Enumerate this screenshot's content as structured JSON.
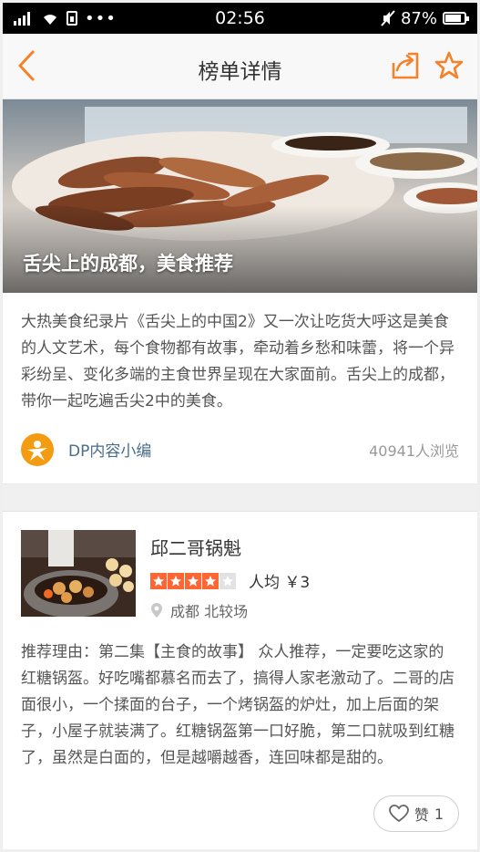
{
  "status_bar": {
    "time": "02:56",
    "battery": "87%",
    "battery_level": 0.87
  },
  "nav": {
    "title": "榜单详情"
  },
  "hero": {
    "title": "舌尖上的成都，美食推荐"
  },
  "description": "大热美食纪录片《舌尖上的中国2》又一次让吃货大呼这是美食的人文艺术，每个食物都有故事，牵动着乡愁和味蕾，将一个异彩纷呈、变化多端的主食世界呈现在大家面前。舌尖上的成都，带你一起吃遍舌尖2中的美食。",
  "author": {
    "name": "DP内容小编",
    "views": "40941人浏览"
  },
  "item": {
    "name": "邱二哥锅魁",
    "rating": 4,
    "rating_max": 5,
    "price": "人均 ￥3",
    "location": "成都 北较场",
    "reason": "推荐理由：第二集【主食的故事】 众人推荐，一定要吃这家的红糖锅盔。好吃嘴都慕名而去了，搞得人家老激动了。二哥的店面很小，一个揉面的台子，一个烤锅盔的炉灶，加上后面的架子，小屋子就装满了。红糖锅盔第一口好脆，第二口就吸到红糖了，虽然是白面的，但是越嚼越香，连回味都是甜的。",
    "like_label": "赞",
    "like_count": "1"
  },
  "colors": {
    "accent": "#f5822a",
    "star": "#ff6633"
  }
}
